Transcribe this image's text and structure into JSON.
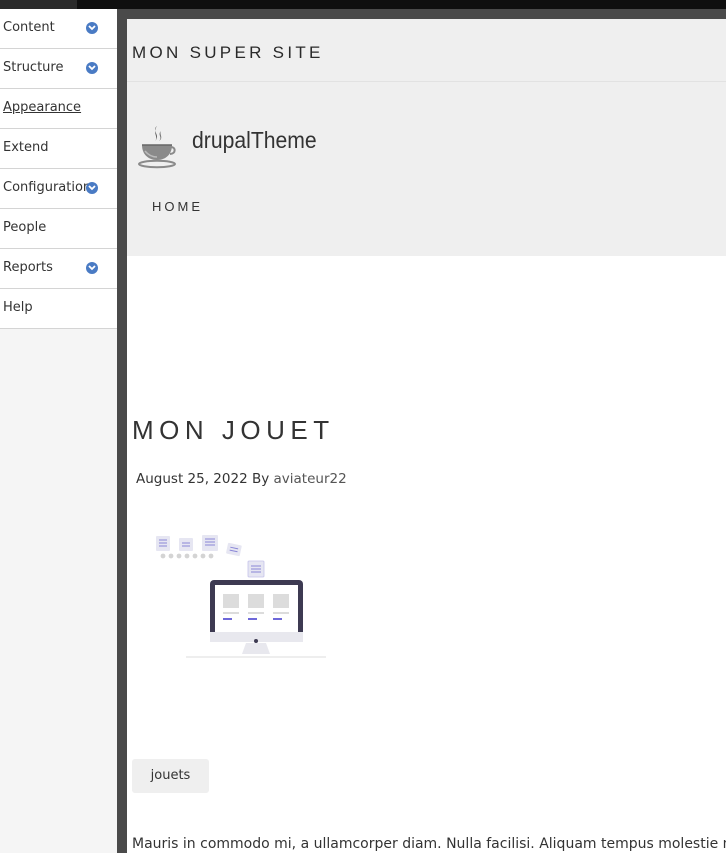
{
  "admin_menu": {
    "items": [
      {
        "label": "Content",
        "has_submenu": true
      },
      {
        "label": "Structure",
        "has_submenu": true
      },
      {
        "label": "Appearance",
        "has_submenu": false,
        "active": true
      },
      {
        "label": "Extend",
        "has_submenu": false
      },
      {
        "label": "Configuration",
        "has_submenu": true
      },
      {
        "label": "People",
        "has_submenu": false
      },
      {
        "label": "Reports",
        "has_submenu": true
      },
      {
        "label": "Help",
        "has_submenu": false
      }
    ]
  },
  "site": {
    "name": "MON SUPER SITE",
    "brand": "drupalTheme",
    "logo_icon": "coffee-cup-icon",
    "nav": {
      "home": "HOME"
    }
  },
  "article": {
    "title": "MON JOUET",
    "date": "August 25, 2022",
    "by": "By",
    "author": "aviateur22",
    "image_icon": "desktop-monitor-illustration",
    "tag": "jouets",
    "body": "Mauris in commodo mi, a ullamcorper diam. Nulla facilisi. Aliquam tempus molestie m"
  },
  "colors": {
    "accent": "#4a7bc4",
    "header_bg": "#efefef",
    "frame": "#4a4a4a"
  }
}
